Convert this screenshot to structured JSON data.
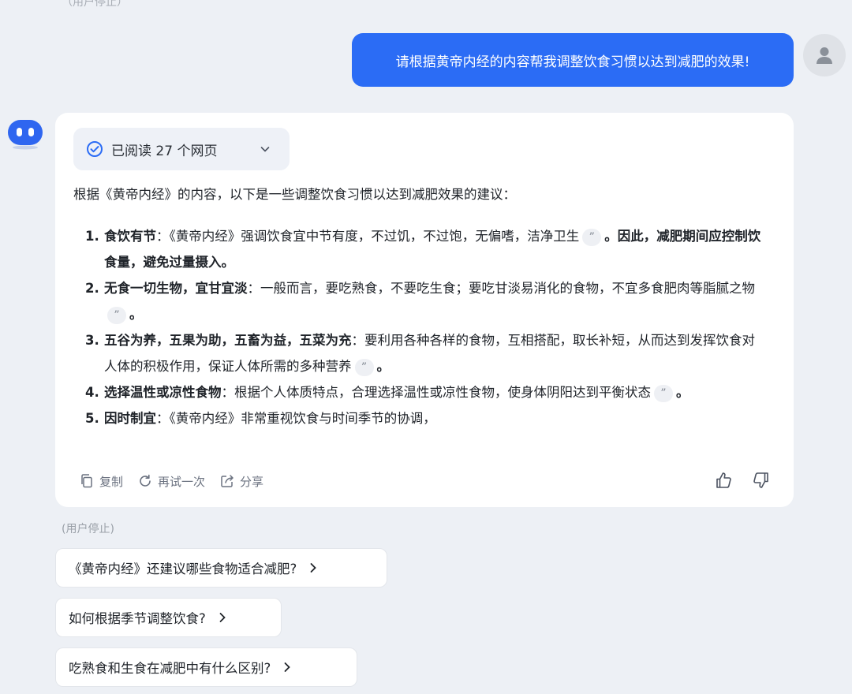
{
  "top_status": "（用户停止）",
  "user_message": "请根据黄帝内经的内容帮我调整饮食习惯以达到减肥的效果!",
  "reply": {
    "read_pages": "已阅读 27 个网页",
    "intro": "根据《黄帝内经》的内容，以下是一些调整饮食习惯以达到减肥效果的建议：",
    "items": [
      {
        "num": "1.",
        "title": "食饮有节",
        "sep": "：",
        "text": "《黄帝内经》强调饮食宜中节有度，不过饥，不过饱，无偏嗜，洁净卫生",
        "after": "。因此，减肥期间应控制饮食量，避免过量摄入。"
      },
      {
        "num": "2.",
        "title": "无食一切生物，宜甘宜淡",
        "sep": "：",
        "text": "一般而言，要吃熟食，不要吃生食；要吃甘淡易消化的食物，不宜多食肥肉等脂腻之物",
        "after": "。"
      },
      {
        "num": "3.",
        "title": "五谷为养，五果为助，五畜为益，五菜为充",
        "sep": "：",
        "text": "要利用各种各样的食物，互相搭配，取长补短，从而达到发挥饮食对人体的积极作用，保证人体所需的多种营养",
        "after": "。"
      },
      {
        "num": "4.",
        "title": "选择温性或凉性食物",
        "sep": "：",
        "text": "根据个人体质特点，合理选择温性或凉性食物，使身体阴阳达到平衡状态",
        "after": "。"
      },
      {
        "num": "5.",
        "title": "因时制宜",
        "sep": "：",
        "text": "《黄帝内经》非常重视饮食与时间季节的协调，",
        "after": ""
      }
    ],
    "actions": {
      "copy": "复制",
      "retry": "再试一次",
      "share": "分享"
    }
  },
  "stopped_label": "(用户停止)",
  "suggestions": [
    "《黄帝内经》还建议哪些食物适合减肥?",
    "如何根据季节调整饮食?",
    "吃熟食和生食在减肥中有什么区别?"
  ]
}
